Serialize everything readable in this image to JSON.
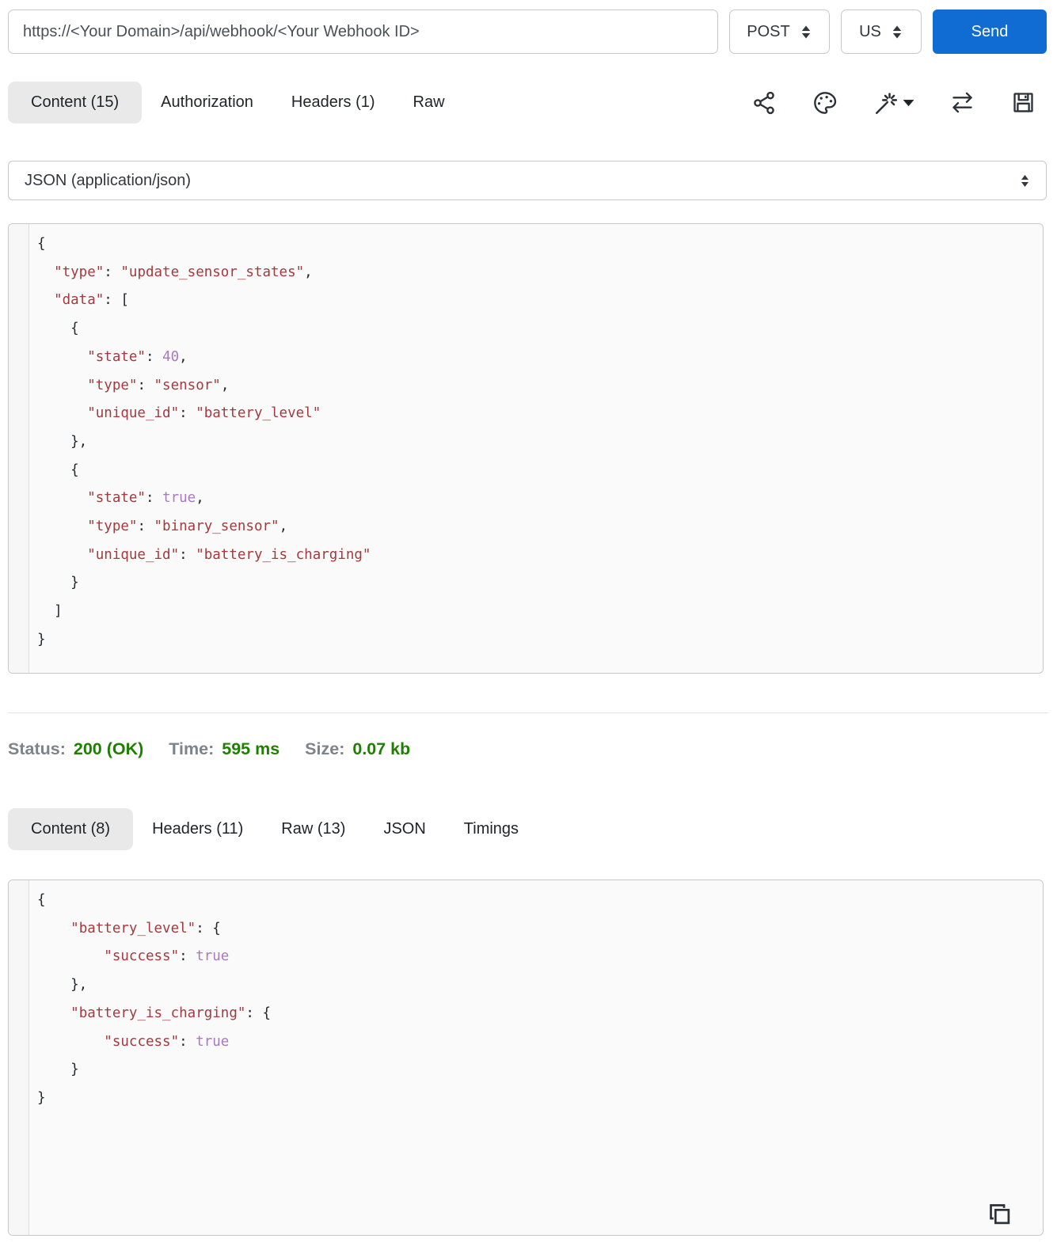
{
  "request_bar": {
    "url_value": "https://<Your Domain>/api/webhook/<Your Webhook ID>",
    "method": "POST",
    "region": "US",
    "send_label": "Send"
  },
  "request_tabs": [
    {
      "label": "Content (15)",
      "active": true
    },
    {
      "label": "Authorization",
      "active": false
    },
    {
      "label": "Headers (1)",
      "active": false
    },
    {
      "label": "Raw",
      "active": false
    }
  ],
  "toolbar_icons": [
    "share-icon",
    "palette-icon",
    "magic-wand-icon",
    "swap-arrows-icon",
    "save-icon"
  ],
  "body_type_select": {
    "value": "JSON (application/json)"
  },
  "request_body": {
    "lines": [
      [
        {
          "c": "p",
          "t": "{"
        }
      ],
      [
        {
          "c": "p",
          "t": "  "
        },
        {
          "c": "s",
          "t": "\"type\""
        },
        {
          "c": "p",
          "t": ": "
        },
        {
          "c": "s",
          "t": "\"update_sensor_states\""
        },
        {
          "c": "p",
          "t": ","
        }
      ],
      [
        {
          "c": "p",
          "t": "  "
        },
        {
          "c": "s",
          "t": "\"data\""
        },
        {
          "c": "p",
          "t": ": ["
        }
      ],
      [
        {
          "c": "p",
          "t": "    {"
        }
      ],
      [
        {
          "c": "p",
          "t": "      "
        },
        {
          "c": "s",
          "t": "\"state\""
        },
        {
          "c": "p",
          "t": ": "
        },
        {
          "c": "a",
          "t": "40"
        },
        {
          "c": "p",
          "t": ","
        }
      ],
      [
        {
          "c": "p",
          "t": "      "
        },
        {
          "c": "s",
          "t": "\"type\""
        },
        {
          "c": "p",
          "t": ": "
        },
        {
          "c": "s",
          "t": "\"sensor\""
        },
        {
          "c": "p",
          "t": ","
        }
      ],
      [
        {
          "c": "p",
          "t": "      "
        },
        {
          "c": "s",
          "t": "\"unique_id\""
        },
        {
          "c": "p",
          "t": ": "
        },
        {
          "c": "s",
          "t": "\"battery_level\""
        }
      ],
      [
        {
          "c": "p",
          "t": "    },"
        }
      ],
      [
        {
          "c": "p",
          "t": "    {"
        }
      ],
      [
        {
          "c": "p",
          "t": "      "
        },
        {
          "c": "s",
          "t": "\"state\""
        },
        {
          "c": "p",
          "t": ": "
        },
        {
          "c": "a",
          "t": "true"
        },
        {
          "c": "p",
          "t": ","
        }
      ],
      [
        {
          "c": "p",
          "t": "      "
        },
        {
          "c": "s",
          "t": "\"type\""
        },
        {
          "c": "p",
          "t": ": "
        },
        {
          "c": "s",
          "t": "\"binary_sensor\""
        },
        {
          "c": "p",
          "t": ","
        }
      ],
      [
        {
          "c": "p",
          "t": "      "
        },
        {
          "c": "s",
          "t": "\"unique_id\""
        },
        {
          "c": "p",
          "t": ": "
        },
        {
          "c": "s",
          "t": "\"battery_is_charging\""
        }
      ],
      [
        {
          "c": "p",
          "t": "    }"
        }
      ],
      [
        {
          "c": "p",
          "t": "  ]"
        }
      ],
      [
        {
          "c": "p",
          "t": "}"
        }
      ]
    ]
  },
  "status_bar": {
    "status_label": "Status:",
    "status_value": "200 (OK)",
    "time_label": "Time:",
    "time_value": "595 ms",
    "size_label": "Size:",
    "size_value": "0.07 kb"
  },
  "response_tabs": [
    {
      "label": "Content (8)",
      "active": true
    },
    {
      "label": "Headers (11)",
      "active": false
    },
    {
      "label": "Raw (13)",
      "active": false
    },
    {
      "label": "JSON",
      "active": false
    },
    {
      "label": "Timings",
      "active": false
    }
  ],
  "response_body": {
    "lines": [
      [
        {
          "c": "p",
          "t": "{"
        }
      ],
      [
        {
          "c": "p",
          "t": "    "
        },
        {
          "c": "s",
          "t": "\"battery_level\""
        },
        {
          "c": "p",
          "t": ": {"
        }
      ],
      [
        {
          "c": "p",
          "t": "        "
        },
        {
          "c": "s",
          "t": "\"success\""
        },
        {
          "c": "p",
          "t": ": "
        },
        {
          "c": "a",
          "t": "true"
        }
      ],
      [
        {
          "c": "p",
          "t": "    },"
        }
      ],
      [
        {
          "c": "p",
          "t": "    "
        },
        {
          "c": "s",
          "t": "\"battery_is_charging\""
        },
        {
          "c": "p",
          "t": ": {"
        }
      ],
      [
        {
          "c": "p",
          "t": "        "
        },
        {
          "c": "s",
          "t": "\"success\""
        },
        {
          "c": "p",
          "t": ": "
        },
        {
          "c": "a",
          "t": "true"
        }
      ],
      [
        {
          "c": "p",
          "t": "    }"
        }
      ],
      [
        {
          "c": "p",
          "t": "}"
        }
      ]
    ]
  },
  "colors": {
    "accent_blue": "#106cd2",
    "status_green": "#1e8000",
    "label_gray": "#7b838b",
    "string_red": "#a43a3e",
    "atom_purple": "#a979c1",
    "active_tab_bg": "#e9e9e9"
  }
}
